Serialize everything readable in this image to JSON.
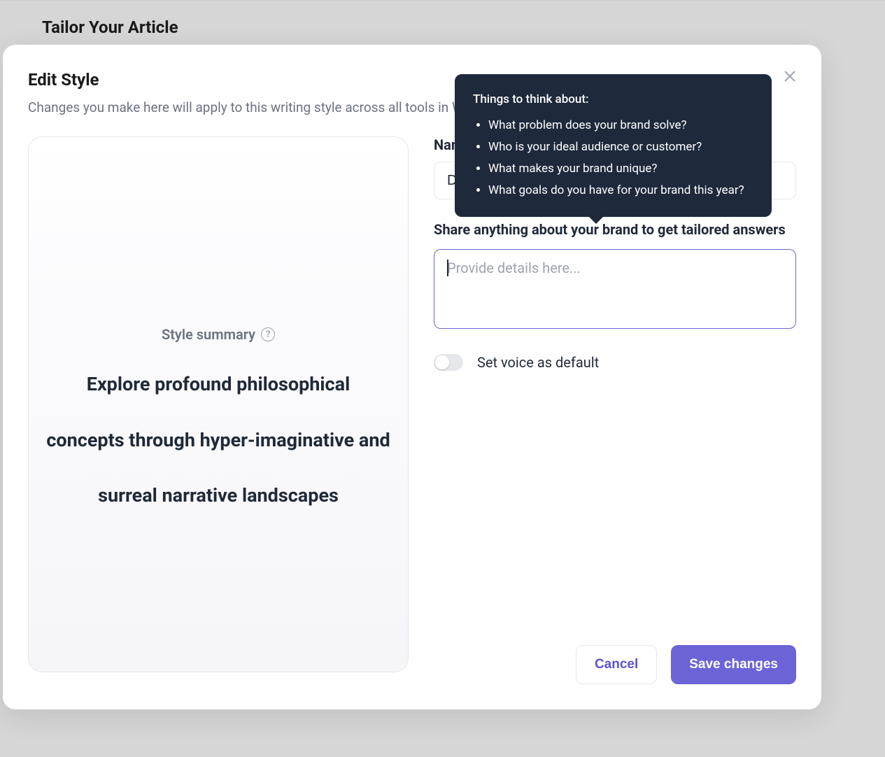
{
  "background": {
    "page_title": "Tailor Your Article"
  },
  "modal": {
    "title": "Edit Style",
    "subtitle": "Changes you make here will apply to this writing style across all tools in Writesonic and Chatsonic."
  },
  "preview": {
    "label": "Style summary",
    "summary_text": "Explore profound philosophical concepts through hyper-imaginative and surreal narrative landscapes"
  },
  "form": {
    "name_label": "Name your style",
    "name_value": "Default",
    "details_label": "Share anything about your brand to get tailored answers",
    "details_placeholder": "Provide details here...",
    "toggle_label": "Set voice as default"
  },
  "tooltip": {
    "title": "Things to think about:",
    "items": [
      "What problem does your brand solve?",
      "Who is your ideal audience or customer?",
      "What makes your brand unique?",
      "What goals do you have for your brand this year?"
    ]
  },
  "buttons": {
    "cancel": "Cancel",
    "save": "Save changes"
  }
}
